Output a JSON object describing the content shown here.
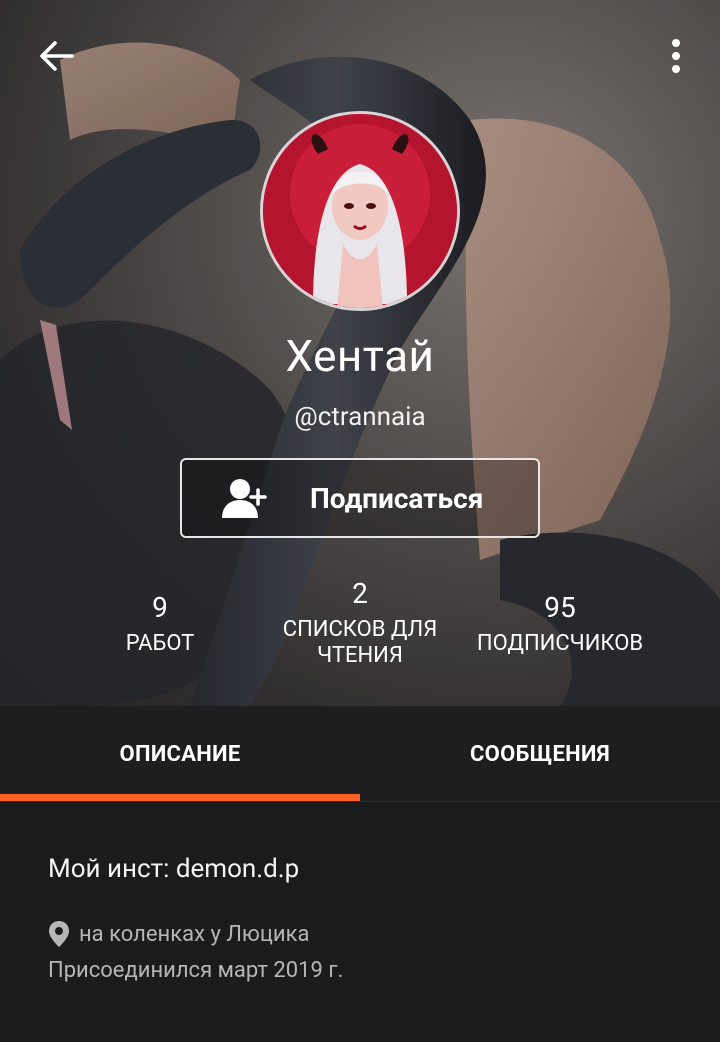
{
  "header": {
    "display_name": "Хентай",
    "username": "@ctrannaia",
    "follow_label": "Подписаться"
  },
  "stats": [
    {
      "value": "9",
      "label": "РАБОТ"
    },
    {
      "value": "2",
      "label": "СПИСКОВ ДЛЯ ЧТЕНИЯ"
    },
    {
      "value": "95",
      "label": "ПОДПИСЧИКОВ"
    }
  ],
  "tabs": [
    {
      "label": "ОПИСАНИЕ",
      "active": true
    },
    {
      "label": "СООБЩЕНИЯ",
      "active": false
    }
  ],
  "about": {
    "text": "Мой инст: demon.d.p",
    "location": "на коленках у Люцика",
    "joined": "Присоединился март 2019 г."
  },
  "icons": {
    "back": "arrow-left-icon",
    "menu": "more-vertical-icon",
    "follow": "add-user-icon",
    "location": "location-pin-icon"
  },
  "colors": {
    "accent": "#ff6122",
    "background": "#1b1a1c"
  }
}
